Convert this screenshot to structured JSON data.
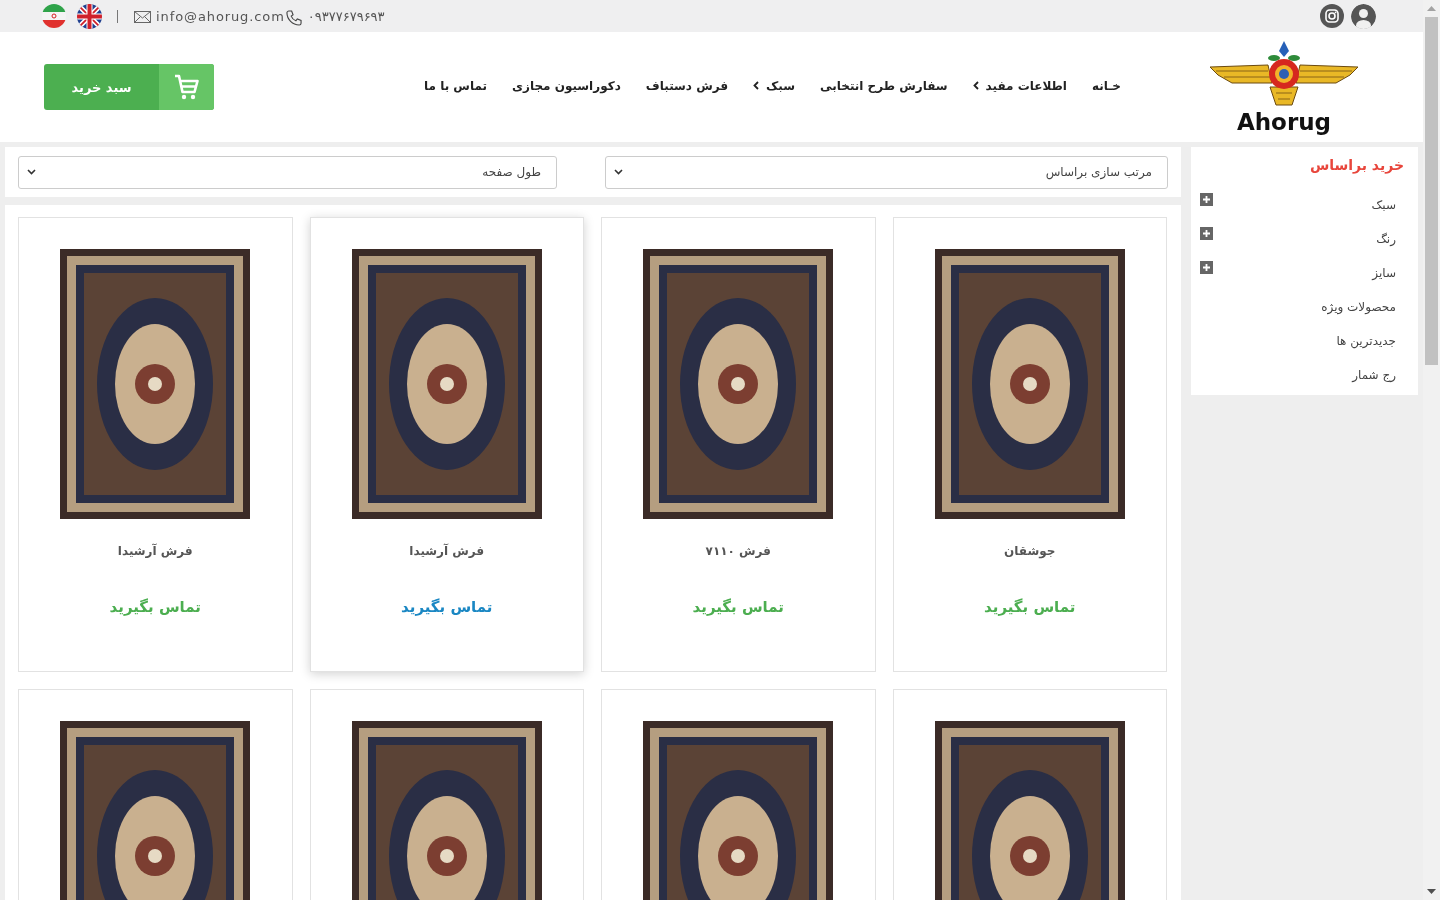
{
  "top_bar": {
    "email": "info@ahorug.com",
    "phone": "۰۹۳۷۷۶۷۹۶۹۳"
  },
  "header": {
    "logo": {
      "text": "Ahorug"
    },
    "nav": [
      {
        "label": "خـانه",
        "dropdown": false
      },
      {
        "label": "اطلاعات مفید",
        "dropdown": true
      },
      {
        "label": "سفارش طرح انتخابی",
        "dropdown": false
      },
      {
        "label": "سبک",
        "dropdown": true
      },
      {
        "label": "فرش دستباف",
        "dropdown": false
      },
      {
        "label": "دکوراسیون مجازی",
        "dropdown": false
      },
      {
        "label": "تماس با ما",
        "dropdown": false
      }
    ],
    "cart_button": {
      "label": "سبد خرید"
    }
  },
  "filters": {
    "sort": {
      "value": "مرتب سازی براساس"
    },
    "page_length": {
      "value": "طول صفحه"
    }
  },
  "sidebar": {
    "title": "خرید براساس",
    "items": [
      {
        "label": "سبک",
        "expandable": true
      },
      {
        "label": "رنگ",
        "expandable": true
      },
      {
        "label": "سایز",
        "expandable": true
      },
      {
        "label": "محصولات ویژه",
        "expandable": false
      },
      {
        "label": "جدیدترین ها",
        "expandable": false
      },
      {
        "label": "رج شمار",
        "expandable": false
      }
    ]
  },
  "products": [
    {
      "name": "جوشقان",
      "link": "تماس بگیرید",
      "hovered": false
    },
    {
      "name": "فرش ۷۱۱۰",
      "link": "تماس بگیرید",
      "hovered": false
    },
    {
      "name": "فرش آرشیدا",
      "link": "تماس بگیرید",
      "hovered": true
    },
    {
      "name": "فرش آرشیدا",
      "link": "تماس بگیرید",
      "hovered": false
    },
    {
      "hovered": false
    },
    {
      "hovered": false
    },
    {
      "hovered": false
    },
    {
      "hovered": false
    }
  ]
}
